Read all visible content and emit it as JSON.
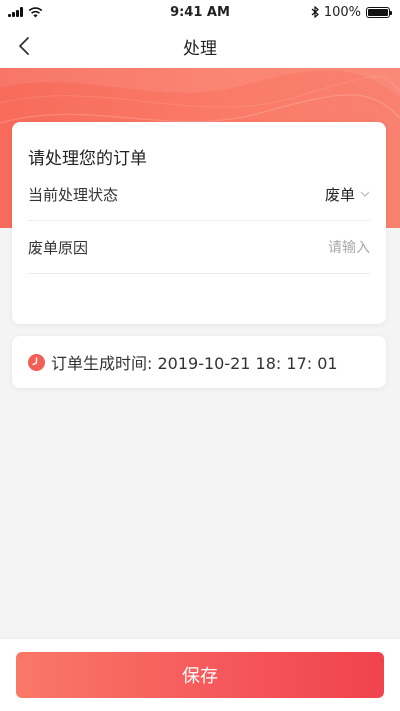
{
  "status_bar": {
    "time": "9:41 AM",
    "battery": "100%",
    "battery_level": 1.0
  },
  "nav": {
    "title": "处理"
  },
  "order_card": {
    "title": "请处理您的订单",
    "rows": [
      {
        "label": "当前处理状态",
        "value": "废单"
      },
      {
        "label": "废单原因",
        "placeholder": "请输入"
      }
    ]
  },
  "time_card": {
    "text": "订单生成时间: 2019-10-21  18: 17: 01"
  },
  "footer": {
    "save_label": "保存"
  },
  "colors": {
    "accent": "#f86b5b",
    "button_start": "#fa7868",
    "button_end": "#f0434d"
  }
}
